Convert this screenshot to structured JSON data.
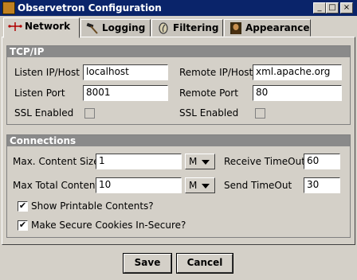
{
  "window": {
    "title": "Observetron Configuration"
  },
  "tabs": [
    "Network",
    "Logging",
    "Filtering",
    "Appearance"
  ],
  "tcpip": {
    "title": "TCP/IP",
    "listen_host_label": "Listen IP/Host",
    "listen_host_value": "localhost",
    "remote_host_label": "Remote IP/Host",
    "remote_host_value": "xml.apache.org",
    "listen_port_label": "Listen Port",
    "listen_port_value": "8001",
    "remote_port_label": "Remote Port",
    "remote_port_value": "80",
    "ssl_left_label": "SSL Enabled",
    "ssl_right_label": "SSL Enabled"
  },
  "connections": {
    "title": "Connections",
    "max_content_label": "Max. Content Size",
    "max_content_value": "1",
    "max_content_unit": "M",
    "receive_timeout_label": "Receive TimeOut",
    "receive_timeout_value": "60",
    "max_total_label": "Max Total Content",
    "max_total_value": "10",
    "max_total_unit": "M",
    "send_timeout_label": "Send TimeOut",
    "send_timeout_value": "30",
    "show_printable_label": "Show Printable Contents?",
    "secure_cookies_label": "Make Secure Cookies In-Secure?"
  },
  "buttons": {
    "save": "Save",
    "cancel": "Cancel"
  },
  "icons": {
    "window": "app-icon",
    "network": "network-icon",
    "logging": "hammer-icon",
    "filtering": "filter-icon",
    "appearance": "painting-icon"
  }
}
